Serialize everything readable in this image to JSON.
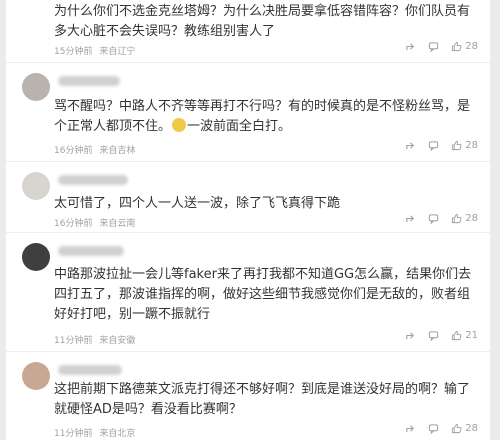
{
  "comments": [
    {
      "text": "为什么你们不选金克丝塔姆？为什么决胜局要拿低容错阵容？你们队员有多大心脏不会失误吗？教练组别害人了",
      "time": "15分钟前",
      "location": "来自辽宁",
      "likes": "28"
    },
    {
      "text_before": "骂不醒吗？中路人不齐等等再打不行吗？有的时候真的是不怪粉丝骂，是个正常人都顶不住。",
      "text_after": "一波前面全白打。",
      "emoji": "smile-emoji",
      "time": "16分钟前",
      "location": "来自吉林",
      "likes": "28"
    },
    {
      "text": "太可惜了，四个人一人送一波，除了飞飞真得下跪",
      "time": "16分钟前",
      "location": "来自云南",
      "likes": "28"
    },
    {
      "text": "中路那波拉扯一会儿等faker来了再打我都不知道GG怎么赢，结果你们去四打五了，那波谁指挥的啊，做好这些细节我感觉你们是无敌的，败者组好好打吧，别一蹶不振就行",
      "time": "11分钟前",
      "location": "来自安徽",
      "likes": "21"
    },
    {
      "text": "这把前期下路德莱文派克打得还不够好啊？到底是谁送没好局的啊？输了就硬怪AD是吗？看没看比赛啊？",
      "time": "11分钟前",
      "location": "来自北京",
      "likes": "28"
    }
  ],
  "colors": {
    "text": "#333333",
    "meta": "#a0a0a0",
    "background": "#ebebeb",
    "card": "#ffffff"
  }
}
